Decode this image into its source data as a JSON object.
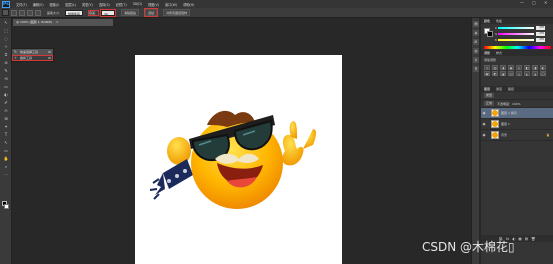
{
  "app": {
    "logo": "Ps",
    "menus": [
      "文件(F)",
      "编辑(E)",
      "图像(I)",
      "图层(L)",
      "类型(Y)",
      "选择(S)",
      "滤镜(T)",
      "3D(D)",
      "视图(V)",
      "窗口(W)",
      "帮助(H)"
    ],
    "window_controls": [
      "—",
      "□",
      "✕"
    ]
  },
  "options": {
    "mode_label": "画笔大小：",
    "mode_value": "抛擦笔画",
    "tolerance_label": "容差：",
    "tolerance_value": "30",
    "antialias_label": "消除锯齿",
    "contiguous_label": "连续",
    "all_layers_label": "对所有图层取样"
  },
  "document": {
    "tab_title": "@ 100% (图层 1, RGB/8)",
    "tab_close": "×"
  },
  "flyout": {
    "items": [
      {
        "label": "快速选择工具",
        "key": "W",
        "icon": "quick-select"
      },
      {
        "label": "魔棒工具",
        "key": "W",
        "icon": "magic-wand"
      }
    ]
  },
  "toolbar": {
    "tools": [
      "↖",
      "⬚",
      "◌",
      "✧",
      "⌗",
      "⊘",
      "✎",
      "⟲",
      "▭",
      "◐",
      "✐",
      "✍",
      "⊞",
      "✦",
      "T",
      "↖",
      "▭",
      "✋",
      "⌕",
      "⋯"
    ]
  },
  "dock": {
    "icons": [
      "▤",
      "◈",
      "⊞",
      "◍",
      "A",
      "¶"
    ]
  },
  "panels": {
    "color_tabs": [
      "颜色",
      "色板"
    ],
    "channels": [
      {
        "name": "R",
        "value": "255",
        "color": "#ff3b3b"
      },
      {
        "name": "G",
        "value": "255",
        "color": "#3bd63b"
      },
      {
        "name": "B",
        "value": "255",
        "color": "#3b6bff"
      }
    ],
    "adjust_tabs": [
      "调整",
      "样式"
    ],
    "adjust_title": "添加调整",
    "adjust_icons": [
      "☼",
      "▥",
      "◑",
      "▣",
      "▽",
      "◧",
      "◨",
      "◐",
      "▦",
      "◩",
      "◪",
      "◫",
      "◬",
      "◭",
      "◮",
      "◯"
    ],
    "layers_tabs": [
      "图层",
      "通道",
      "路径"
    ],
    "kind_label": "类型",
    "blend_label": "正常",
    "opacity_label": "不透明度：100%",
    "layers": [
      {
        "name": "图层 1 拷贝",
        "selected": true,
        "locked": false
      },
      {
        "name": "图层 1",
        "selected": false,
        "locked": false
      },
      {
        "name": "背景",
        "selected": false,
        "locked": true
      }
    ],
    "layer_bottom_icons": [
      "⛓",
      "fx",
      "◐",
      "▦",
      "▤",
      "🗑"
    ]
  },
  "watermark": "CSDN @木棉花▯"
}
